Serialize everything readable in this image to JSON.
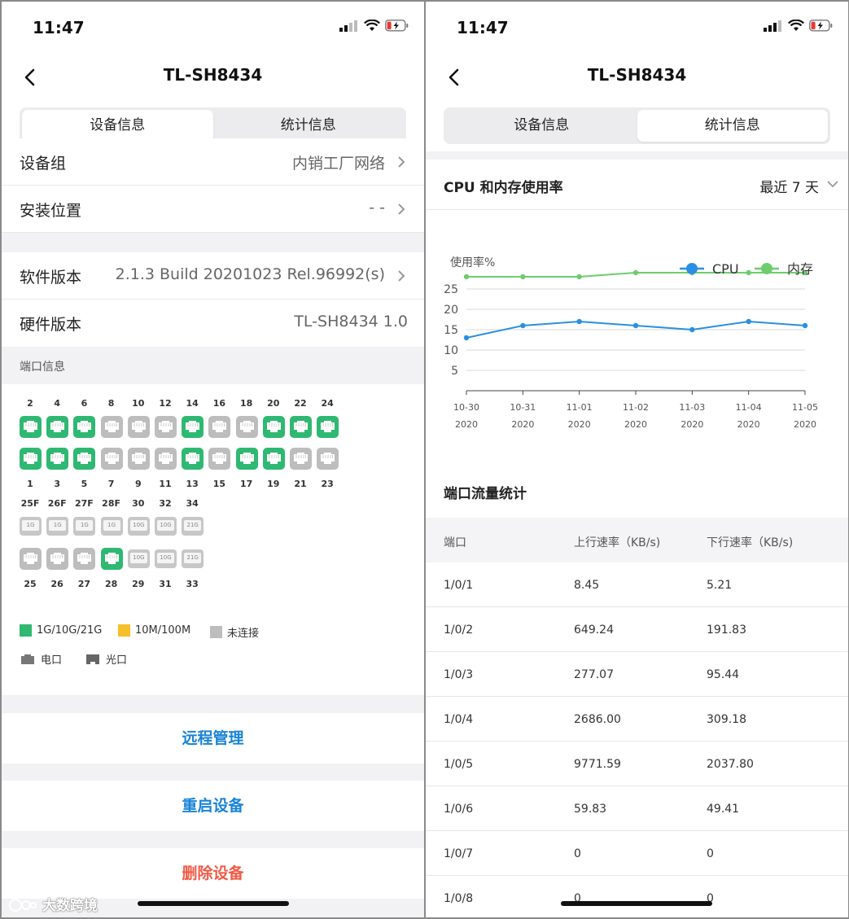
{
  "status": {
    "time": "11:47"
  },
  "nav": {
    "title": "TL-SH8434"
  },
  "tabs": [
    {
      "label": "设备信息"
    },
    {
      "label": "统计信息"
    }
  ],
  "left": {
    "rows": [
      {
        "key": "设备组",
        "value": "内销工厂网络"
      },
      {
        "key": "安装位置",
        "value": "- -"
      },
      {
        "key": "软件版本",
        "value": "2.1.3 Build 20201023 Rel.96992(s)"
      },
      {
        "key": "硬件版本",
        "value": "TL-SH8434 1.0"
      }
    ],
    "port_section_title": "端口信息",
    "top_numbers": [
      "2",
      "4",
      "6",
      "8",
      "10",
      "12",
      "14",
      "16",
      "18",
      "20",
      "22",
      "24"
    ],
    "bottom_numbers": [
      "1",
      "3",
      "5",
      "7",
      "9",
      "11",
      "13",
      "15",
      "17",
      "19",
      "21",
      "23"
    ],
    "top_status": [
      "green",
      "green",
      "green",
      "gray",
      "gray",
      "gray",
      "green",
      "gray",
      "gray",
      "green",
      "green",
      "green"
    ],
    "bottom_status": [
      "green",
      "green",
      "green",
      "gray",
      "gray",
      "gray",
      "green",
      "gray",
      "green",
      "green",
      "gray",
      "gray"
    ],
    "sfp_top_numbers": [
      "25F",
      "26F",
      "27F",
      "28F",
      "30",
      "32",
      "34"
    ],
    "sfp_top_labels": [
      "1G",
      "1G",
      "1G",
      "1G",
      "10G",
      "10G",
      "21G"
    ],
    "sfp_bottom_numbers": [
      "25",
      "26",
      "27",
      "28",
      "29",
      "31",
      "33"
    ],
    "sfp_bottom_labels": [
      "",
      "",
      "",
      "",
      "10G",
      "10G",
      "21G"
    ],
    "legend": {
      "green": "1G/10G/21G",
      "yellow": "10M/100M",
      "gray": "未连接",
      "electric": "电口",
      "optical": "光口"
    },
    "actions": {
      "remote": "远程管理",
      "reboot": "重启设备",
      "delete": "删除设备"
    },
    "colors": {
      "green": "#2fb872",
      "yellow": "#f5c02a",
      "gray": "#bdbdbd",
      "blue": "#1a84d6",
      "red": "#f05a46"
    }
  },
  "right": {
    "chart_title": "CPU 和内存使用率",
    "range_label": "最近 7 天",
    "table_title": "端口流量统计",
    "table_headers": [
      "端口",
      "上行速率（KB/s)",
      "下行速率（KB/s)"
    ],
    "table_rows": [
      [
        "1/0/1",
        "8.45",
        "5.21"
      ],
      [
        "1/0/2",
        "649.24",
        "191.83"
      ],
      [
        "1/0/3",
        "277.07",
        "95.44"
      ],
      [
        "1/0/4",
        "2686.00",
        "309.18"
      ],
      [
        "1/0/5",
        "9771.59",
        "2037.80"
      ],
      [
        "1/0/6",
        "59.83",
        "49.41"
      ],
      [
        "1/0/7",
        "0",
        "0"
      ],
      [
        "1/0/8",
        "0",
        "0"
      ]
    ]
  },
  "chart_data": {
    "type": "line",
    "ylabel": "使用率%",
    "x": [
      "10-30",
      "10-31",
      "11-01",
      "11-02",
      "11-03",
      "11-04",
      "11-05"
    ],
    "x_sub": [
      "2020",
      "2020",
      "2020",
      "2020",
      "2020",
      "2020",
      "2020"
    ],
    "yticks": [
      5,
      10,
      15,
      20,
      25
    ],
    "ylim": [
      0,
      30
    ],
    "grid": true,
    "legend_position": "top-right",
    "series": [
      {
        "name": "CPU",
        "color": "#2a8fe0",
        "values": [
          13,
          16,
          17,
          16,
          15,
          17,
          16
        ]
      },
      {
        "name": "内存",
        "color": "#6dcd6e",
        "values": [
          28,
          28,
          28,
          29,
          29,
          29,
          29
        ]
      }
    ]
  },
  "watermark": "大数跨境"
}
